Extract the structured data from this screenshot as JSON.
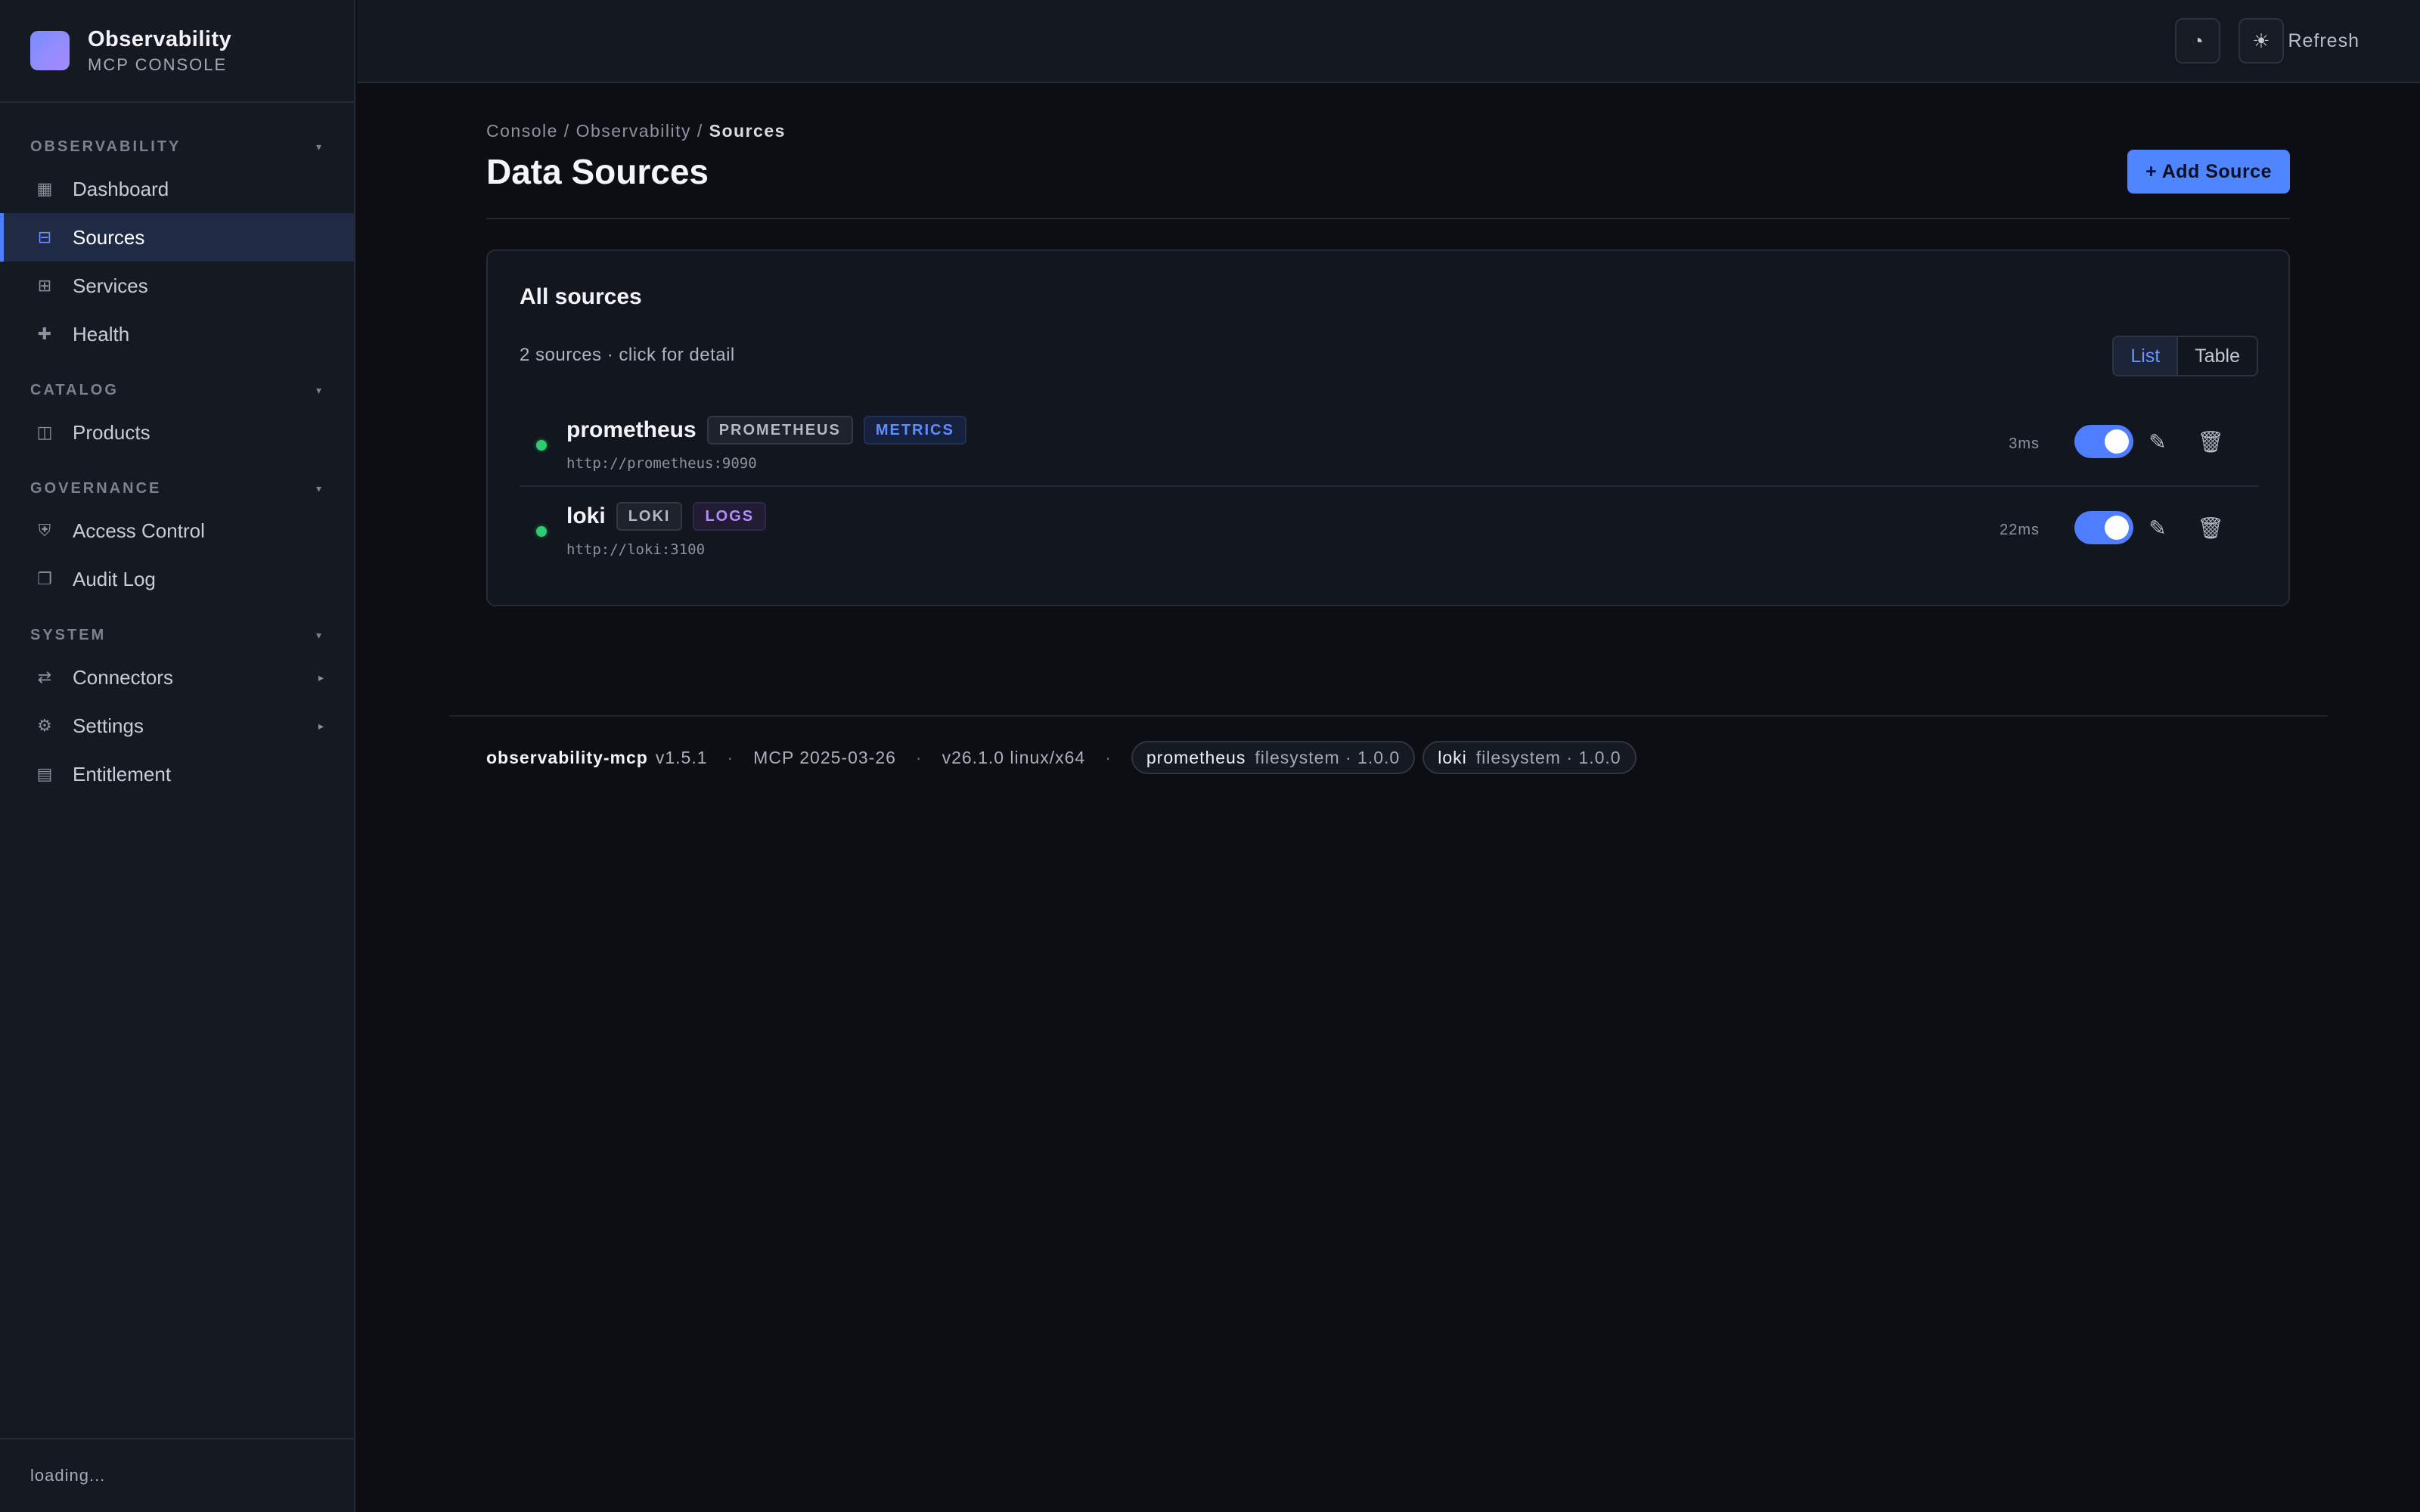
{
  "brand": {
    "title": "Observability",
    "subtitle": "MCP CONSOLE"
  },
  "sidebar": {
    "sections": [
      {
        "label": "OBSERVABILITY",
        "items": [
          {
            "label": "Dashboard",
            "icon": "grid-icon"
          },
          {
            "label": "Sources",
            "icon": "database-icon",
            "active": true
          },
          {
            "label": "Services",
            "icon": "services-icon"
          },
          {
            "label": "Health",
            "icon": "plus-icon"
          }
        ]
      },
      {
        "label": "CATALOG",
        "items": [
          {
            "label": "Products",
            "icon": "book-icon"
          }
        ]
      },
      {
        "label": "GOVERNANCE",
        "items": [
          {
            "label": "Access Control",
            "icon": "shield-icon"
          },
          {
            "label": "Audit Log",
            "icon": "document-icon"
          }
        ]
      },
      {
        "label": "SYSTEM",
        "items": [
          {
            "label": "Connectors",
            "icon": "plug-icon",
            "submenu": true
          },
          {
            "label": "Settings",
            "icon": "gear-icon",
            "submenu": true
          },
          {
            "label": "Entitlement",
            "icon": "license-icon"
          }
        ]
      }
    ],
    "footer": "loading..."
  },
  "topbar": {
    "refresh_label": "Refresh"
  },
  "breadcrumb": {
    "part1": "Console",
    "sep": " / ",
    "part2": "Observability",
    "current": "Sources"
  },
  "page": {
    "title": "Data Sources",
    "add_label": "+ Add Source"
  },
  "card": {
    "title": "All sources",
    "subtitle": "2 sources · click for detail",
    "view_list": "List",
    "view_table": "Table"
  },
  "sources": [
    {
      "name": "prometheus",
      "type": "PROMETHEUS",
      "kind": "METRICS",
      "url": "http://prometheus:9090",
      "latency": "3ms",
      "enabled": true
    },
    {
      "name": "loki",
      "type": "LOKI",
      "kind": "LOGS",
      "url": "http://loki:3100",
      "latency": "22ms",
      "enabled": true
    }
  ],
  "footer": {
    "app": "observability-mcp",
    "version": "v1.5.1",
    "mcp": "MCP 2025-03-26",
    "runtime": "v26.1.0 linux/x64",
    "sep": "·",
    "pills": [
      {
        "name": "prometheus",
        "meta": "filesystem · 1.0.0"
      },
      {
        "name": "loki",
        "meta": "filesystem · 1.0.0"
      }
    ]
  },
  "colors": {
    "accent": "#4f86ff",
    "status_ok": "#2ecc71",
    "background": "#0c0e13"
  }
}
